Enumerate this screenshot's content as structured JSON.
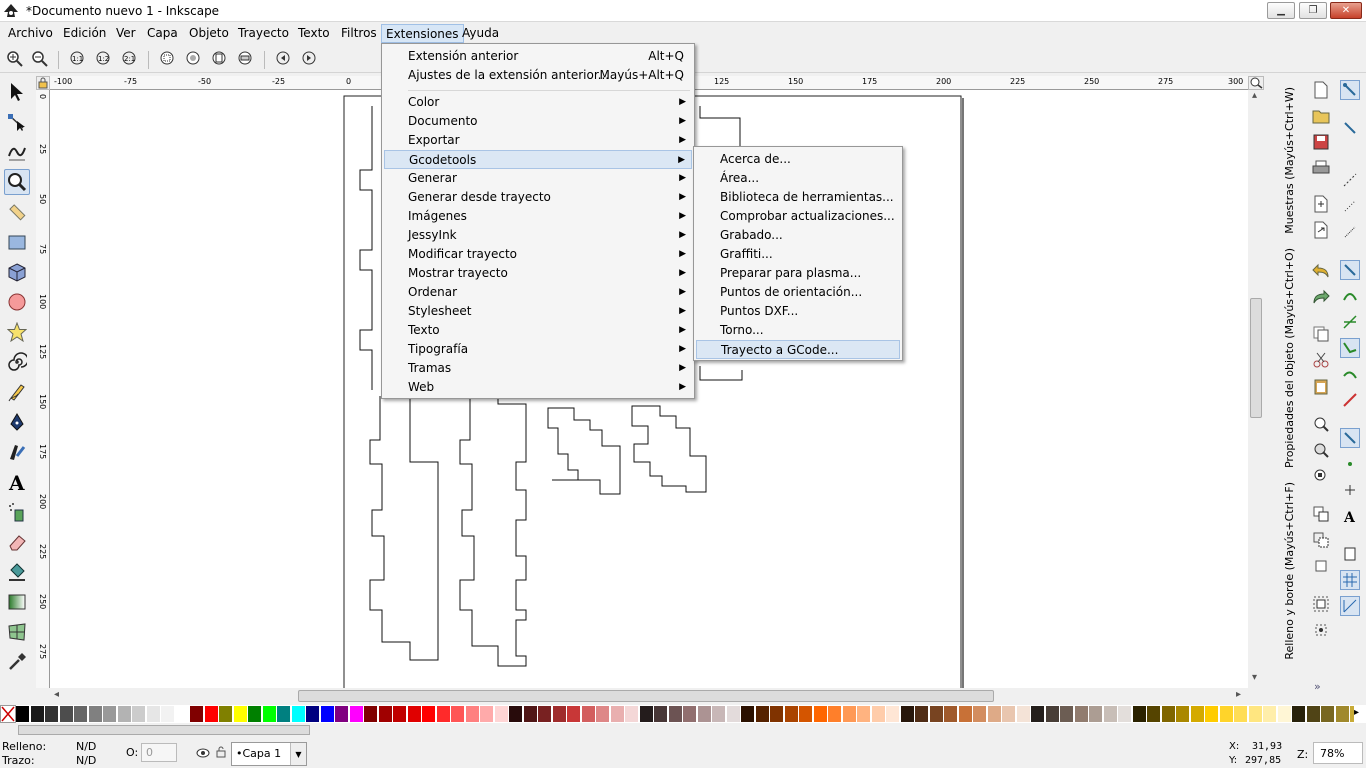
{
  "window": {
    "title": "*Documento nuevo 1 - Inkscape",
    "controls": [
      "minimize",
      "restore",
      "close"
    ]
  },
  "menubar": {
    "items": [
      "Archivo",
      "Edición",
      "Ver",
      "Capa",
      "Objeto",
      "Trayecto",
      "Texto",
      "Filtros",
      "Extensiones",
      "Ayuda"
    ],
    "open_item": "Extensiones"
  },
  "extensions_menu": {
    "top": [
      {
        "label": "Extensión anterior",
        "accel": "Alt+Q"
      },
      {
        "label": "Ajustes de la extensión anterior...",
        "accel": "Mayús+Alt+Q"
      }
    ],
    "submenus": [
      "Color",
      "Documento",
      "Exportar",
      "Gcodetools",
      "Generar",
      "Generar desde trayecto",
      "Imágenes",
      "JessyInk",
      "Modificar trayecto",
      "Mostrar trayecto",
      "Ordenar",
      "Stylesheet",
      "Texto",
      "Tipografía",
      "Tramas",
      "Web"
    ],
    "highlighted": "Gcodetools"
  },
  "gcodetools_menu": {
    "items": [
      "Acerca de...",
      "Área...",
      "Biblioteca de herramientas...",
      "Comprobar actualizaciones...",
      "Grabado...",
      "Graffiti...",
      "Preparar para plasma...",
      "Puntos de orientación...",
      "Puntos DXF...",
      "Torno...",
      "Trayecto a GCode..."
    ],
    "highlighted": "Trayecto a GCode..."
  },
  "ruler": {
    "h_labels": [
      "-100",
      "-75",
      "-50",
      "-25",
      "0",
      "125",
      "150",
      "175",
      "200",
      "225",
      "250",
      "275",
      "300"
    ],
    "v_labels": [
      "0",
      "25",
      "50",
      "75",
      "100",
      "125",
      "150",
      "175",
      "200",
      "225",
      "250",
      "275"
    ]
  },
  "docked_dialogs": [
    "Muestras (Mayús+Ctrl+W)",
    "Propiedades del objeto (Mayús+Ctrl+O)",
    "Relleno y borde (Mayús+Ctrl+F)"
  ],
  "palette": {
    "colors": [
      "#000000",
      "#1a1a1a",
      "#333333",
      "#4d4d4d",
      "#666666",
      "#808080",
      "#999999",
      "#b3b3b3",
      "#cccccc",
      "#e6e6e6",
      "#f2f2f2",
      "#ffffff",
      "#800000",
      "#ff0000",
      "#808000",
      "#ffff00",
      "#008000",
      "#00ff00",
      "#008080",
      "#00ffff",
      "#000080",
      "#0000ff",
      "#800080",
      "#ff00ff",
      "#800000",
      "#a00000",
      "#c00000",
      "#e00000",
      "#ff0000",
      "#ff2a2a",
      "#ff5555",
      "#ff8080",
      "#ffaaaa",
      "#ffd5d5",
      "#280b0b",
      "#501616",
      "#782121",
      "#a02c2c",
      "#c83737",
      "#d35f5f",
      "#de8787",
      "#e9afaf",
      "#f4d7d7",
      "#241c1c",
      "#483737",
      "#6c5353",
      "#916f6f",
      "#ac9393",
      "#c8b7b7",
      "#e3dbdb",
      "#2b1100",
      "#552200",
      "#803300",
      "#aa4400",
      "#d45500",
      "#ff6600",
      "#ff7f2a",
      "#ff9955",
      "#ffb380",
      "#ffccaa",
      "#ffe6d5",
      "#28170b",
      "#502d16",
      "#784421",
      "#a05a2c",
      "#c87137",
      "#d38d5f",
      "#deaa87",
      "#e9c6af",
      "#f4e3d7",
      "#241f1c",
      "#483e37",
      "#6c5d53",
      "#917c6f",
      "#ac9d93",
      "#c8beb7",
      "#e3dedb",
      "#2b2200",
      "#554400",
      "#806600",
      "#aa8800",
      "#d4aa00",
      "#ffcc00",
      "#ffd42a",
      "#ffdd55",
      "#ffe680",
      "#ffeeaa",
      "#fff6d5",
      "#28220b",
      "#504416",
      "#786721",
      "#a0892c",
      "#c8ab37"
    ]
  },
  "status": {
    "fill_label": "Relleno:",
    "fill_value": "N/D",
    "stroke_label": "Trazo:",
    "stroke_value": "N/D",
    "opacity_label": "O:",
    "opacity_value": "0",
    "layer": "•Capa 1",
    "x_label": "X:",
    "x_value": "31,93",
    "y_label": "Y:",
    "y_value": "297,85",
    "zoom_label": "Z:",
    "zoom_value": "78%"
  }
}
